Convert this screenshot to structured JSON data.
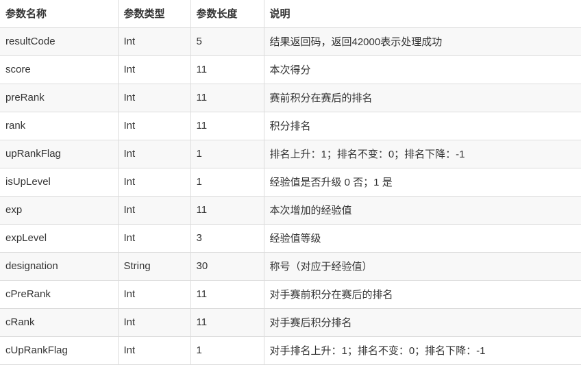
{
  "table": {
    "headers": [
      "参数名称",
      "参数类型",
      "参数长度",
      "说明"
    ],
    "rows": [
      {
        "name": "resultCode",
        "type": "Int",
        "length": "5",
        "desc": "结果返回码，返回42000表示处理成功"
      },
      {
        "name": "score",
        "type": "Int",
        "length": "11",
        "desc": "本次得分"
      },
      {
        "name": "preRank",
        "type": "Int",
        "length": "11",
        "desc": "赛前积分在赛后的排名"
      },
      {
        "name": "rank",
        "type": "Int",
        "length": "11",
        "desc": "积分排名"
      },
      {
        "name": "upRankFlag",
        "type": "Int",
        "length": "1",
        "desc": "排名上升：1；排名不变：0；排名下降：-1"
      },
      {
        "name": "isUpLevel",
        "type": "Int",
        "length": "1",
        "desc": "经验值是否升级 0 否；1 是"
      },
      {
        "name": "exp",
        "type": "Int",
        "length": "11",
        "desc": "本次增加的经验值"
      },
      {
        "name": "expLevel",
        "type": "Int",
        "length": "3",
        "desc": "经验值等级"
      },
      {
        "name": "designation",
        "type": "String",
        "length": "30",
        "desc": "称号（对应于经验值）"
      },
      {
        "name": "cPreRank",
        "type": "Int",
        "length": "11",
        "desc": "对手赛前积分在赛后的排名"
      },
      {
        "name": "cRank",
        "type": "Int",
        "length": "11",
        "desc": "对手赛后积分排名"
      },
      {
        "name": "cUpRankFlag",
        "type": "Int",
        "length": "1",
        "desc": "对手排名上升：1；排名不变：0；排名下降：-1"
      }
    ]
  }
}
